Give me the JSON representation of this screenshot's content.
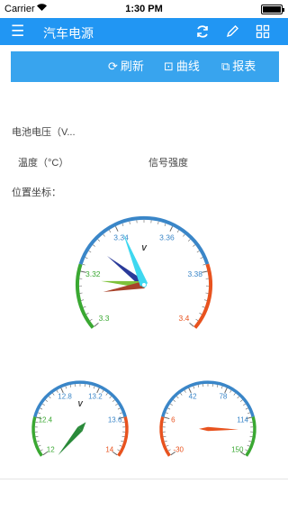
{
  "status_bar": {
    "carrier": "Carrier",
    "time": "1:30 PM"
  },
  "nav": {
    "title": "汽车电源",
    "menu_icon": "menu-icon",
    "refresh_icon": "refresh-icon",
    "edit_icon": "pencil-icon",
    "grid_icon": "grid-icon"
  },
  "toolbar": {
    "refresh_label": "刷新",
    "curve_label": "曲线",
    "report_label": "报表"
  },
  "info": {
    "battery_voltage": "电池电压（V...",
    "temperature": "温度（°C）",
    "signal_strength": "信号强度",
    "position": "位置坐标："
  },
  "gauges": {
    "voltage": {
      "unit": "V",
      "ticks": [
        {
          "value": "3.3",
          "color": "#3aa832"
        },
        {
          "value": "3.32",
          "color": "#3aa832"
        },
        {
          "value": "3.34",
          "color": "#3a86c8"
        },
        {
          "value": "3.36",
          "color": "#3a86c8"
        },
        {
          "value": "3.38",
          "color": "#3a86c8"
        },
        {
          "value": "3.4",
          "color": "#e8531f"
        }
      ],
      "needles": [
        {
          "color": "#2a3a9a"
        },
        {
          "color": "#7ec23a"
        },
        {
          "color": "#a8422a"
        },
        {
          "color": "#3ed8f0"
        }
      ]
    },
    "small_left": {
      "unit": "V",
      "ticks": [
        {
          "value": "12",
          "color": "#3aa832"
        },
        {
          "value": "12.4",
          "color": "#3aa832"
        },
        {
          "value": "12.8",
          "color": "#3a86c8"
        },
        {
          "value": "13.2",
          "color": "#3a86c8"
        },
        {
          "value": "13.6",
          "color": "#3a86c8"
        },
        {
          "value": "14",
          "color": "#e8531f"
        }
      ],
      "needle_color": "#2a8a3a"
    },
    "small_right": {
      "ticks": [
        {
          "value": "-30",
          "color": "#e8531f"
        },
        {
          "value": "6",
          "color": "#e8531f"
        },
        {
          "value": "42",
          "color": "#3a86c8"
        },
        {
          "value": "78",
          "color": "#3a86c8"
        },
        {
          "value": "114",
          "color": "#3a86c8"
        },
        {
          "value": "150",
          "color": "#3aa832"
        }
      ],
      "needle_color": "#e8531f"
    }
  },
  "colors": {
    "nav": "#2196f3",
    "toolbar": "#38a4ee",
    "green": "#3aa832",
    "blue": "#3a86c8",
    "red": "#e8531f"
  }
}
